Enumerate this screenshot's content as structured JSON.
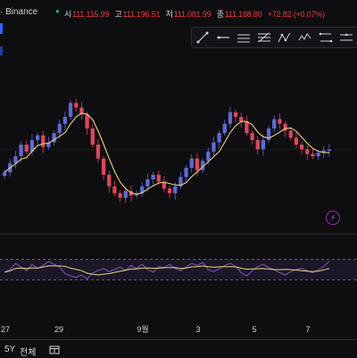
{
  "header": {
    "title": "· Binance",
    "ohlc": [
      {
        "k": "시",
        "v": "111,115.99"
      },
      {
        "k": "고",
        "v": "111,196.51"
      },
      {
        "k": "저",
        "v": "111,081.99"
      },
      {
        "k": "종",
        "v": "111,188.80"
      }
    ],
    "change": "+72.82 (+0.07%)"
  },
  "drawing_tools": [
    "line-tool-icon",
    "horizontal-ray-icon",
    "parallel-channel-icon",
    "fib-tool-icon",
    "pattern-tool-icon",
    "path-tool-icon",
    "projection-tool-icon",
    "measure-tool-icon"
  ],
  "x_axis": {
    "labels": [
      "27",
      "29",
      "9월",
      "3",
      "5",
      "7"
    ]
  },
  "bottom": {
    "range": "5Y",
    "all": "전체"
  },
  "colors": {
    "up": "#22ab94",
    "down": "#f23645",
    "ma": "#e8d37a",
    "rsi": "#7e57c2",
    "candle_up": "#5b6bd6",
    "candle_down": "#e0455a"
  },
  "chart_data": [
    {
      "type": "candlestick",
      "title": "",
      "series": [
        {
          "values": [
            110200,
            110600,
            110900,
            111400,
            111100,
            111600,
            111800,
            111300,
            111500,
            111900,
            112300,
            112600,
            113200,
            113000,
            112700,
            112100,
            111400,
            110800,
            110100,
            109600,
            109300,
            109100,
            109400,
            109200,
            109300,
            109600,
            109900,
            110100,
            109800,
            109500,
            109300,
            109600,
            110000,
            110400,
            110800,
            110300,
            110700,
            111100,
            111500,
            111900,
            112300,
            112800,
            112600,
            112400,
            111900,
            111600,
            111200,
            111600,
            112100,
            112500,
            112300,
            112000,
            111700,
            111400,
            111200,
            111000,
            110900,
            111050,
            111150,
            111189
          ]
        }
      ],
      "ma_line": true
    },
    {
      "type": "line",
      "title": "",
      "series": [
        {
          "values": [
            45,
            50,
            62,
            55,
            48,
            60,
            52,
            58,
            66,
            60,
            55,
            42,
            38,
            35,
            40,
            32,
            44,
            48,
            52,
            46,
            50,
            55,
            48,
            58,
            52,
            60,
            50,
            45,
            56,
            54,
            60,
            52,
            48,
            55,
            62,
            58,
            64,
            50,
            46,
            52,
            58,
            62,
            56,
            44,
            38,
            48,
            56,
            60,
            54,
            50,
            44,
            40,
            46,
            50,
            52,
            48,
            44,
            50,
            56,
            66
          ]
        }
      ],
      "ma_line": true,
      "bands": [
        30,
        70
      ]
    }
  ]
}
